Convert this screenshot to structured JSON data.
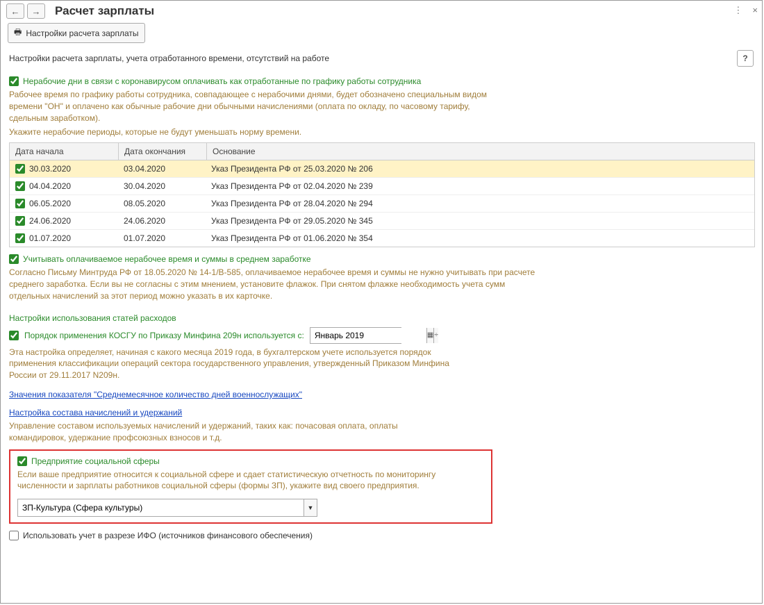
{
  "header": {
    "back": "←",
    "forward": "→",
    "title": "Расчет зарплаты",
    "menu_glyph": "⋮",
    "close_glyph": "×"
  },
  "toolbar": {
    "print_icon": "🖶",
    "settings_btn": "Настройки расчета зарплаты"
  },
  "subtitle": "Настройки расчета зарплаты, учета отработанного времени, отсутствий на работе",
  "help": "?",
  "covid": {
    "label": "Нерабочие дни в связи с коронавирусом оплачивать как отработанные по графику работы сотрудника",
    "desc": "Рабочее время по графику работы сотрудника, совпадающее с нерабочими днями, будет обозначено специальным видом времени \"ОН\" и оплачено как обычные рабочие дни обычными начислениями (оплата по окладу, по часовому тарифу, сдельным заработком).",
    "hint": "Укажите нерабочие периоды, которые не будут уменьшать норму времени."
  },
  "grid": {
    "h1": "Дата начала",
    "h2": "Дата окончания",
    "h3": "Основание",
    "rows": [
      {
        "start": "30.03.2020",
        "end": "03.04.2020",
        "basis": "Указ Президента РФ от 25.03.2020 № 206",
        "sel": true
      },
      {
        "start": "04.04.2020",
        "end": "30.04.2020",
        "basis": "Указ Президента РФ от 02.04.2020 № 239"
      },
      {
        "start": "06.05.2020",
        "end": "08.05.2020",
        "basis": "Указ Президента РФ от 28.04.2020 № 294"
      },
      {
        "start": "24.06.2020",
        "end": "24.06.2020",
        "basis": "Указ Президента РФ от 29.05.2020 № 345"
      },
      {
        "start": "01.07.2020",
        "end": "01.07.2020",
        "basis": "Указ Президента РФ от 01.06.2020 № 354"
      }
    ]
  },
  "avg": {
    "label": "Учитывать оплачиваемое нерабочее время и суммы в среднем заработке",
    "desc": "Согласно Письму Минтруда РФ от 18.05.2020 № 14-1/В-585, оплачиваемое нерабочее время и суммы не нужно учитывать при расчете среднего заработка. Если вы не согласны с этим мнением, установите флажок. При снятом флажке необходимость учета сумм отдельных начислений за этот период можно указать в их карточке."
  },
  "kosgu": {
    "header": "Настройки использования статей расходов",
    "label": "Порядок применения КОСГУ по Приказу Минфина 209н используется с:",
    "date": "Январь 2019",
    "desc": "Эта настройка определяет, начиная с какого месяца 2019 года, в бухгалтерском учете используется порядок применения классификации операций сектора государственного управления, утвержденный Приказом Минфина России от 29.11.2017 N209н."
  },
  "links": {
    "l1": "Значения показателя \"Среднемесячное количество дней военнослужащих\"",
    "l2": "Настройка состава начислений и удержаний"
  },
  "mgmt_desc": "Управление составом используемых начислений и удержаний, таких как: почасовая оплата, оплаты командировок, удержание профсоюзных взносов и т.д.",
  "social": {
    "label": "Предприятие социальной сферы",
    "desc": "Если ваше предприятие относится к социальной сфере и сдает статистическую отчетность по мониторингу численности и зарплаты работников социальной сферы (формы ЗП), укажите вид своего предприятия.",
    "value": "ЗП-Культура (Сфера культуры)"
  },
  "ifo": {
    "label": "Использовать учет в разрезе ИФО (источников финансового обеспечения)"
  }
}
